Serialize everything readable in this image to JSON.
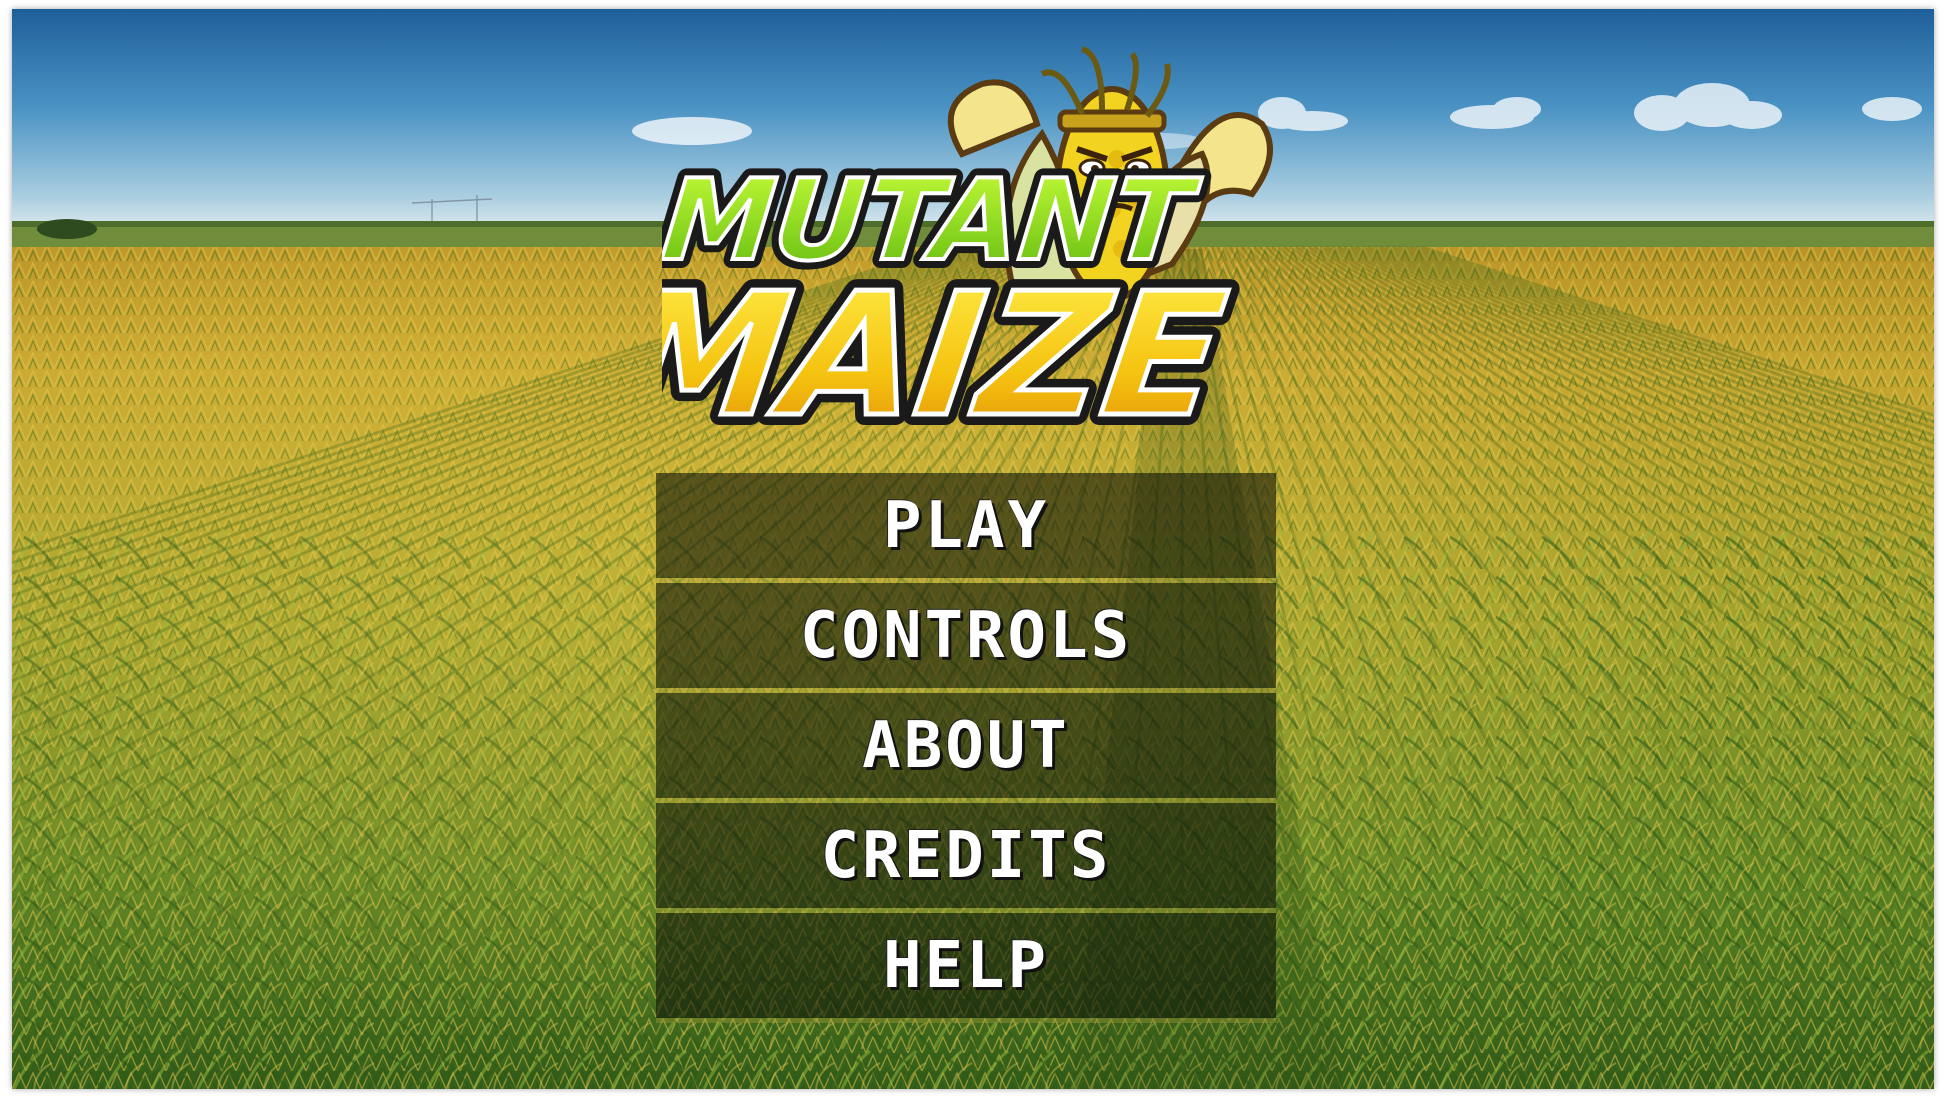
{
  "title": {
    "line1": "MUTANT",
    "line2": "MAIZE"
  },
  "menu": {
    "items": [
      {
        "label": "PLAY"
      },
      {
        "label": "CONTROLS"
      },
      {
        "label": "ABOUT"
      },
      {
        "label": "CREDITS"
      },
      {
        "label": "HELP"
      }
    ]
  },
  "colors": {
    "sky_top": "#1f6fae",
    "sky_horizon": "#cfe4ee",
    "field_far": "#c9a22e",
    "field_near": "#3f6b1e",
    "title_line1": "#8fe01a",
    "title_line2": "#f3c10c"
  },
  "icons": {
    "mascot": "corn-mascot-icon"
  }
}
